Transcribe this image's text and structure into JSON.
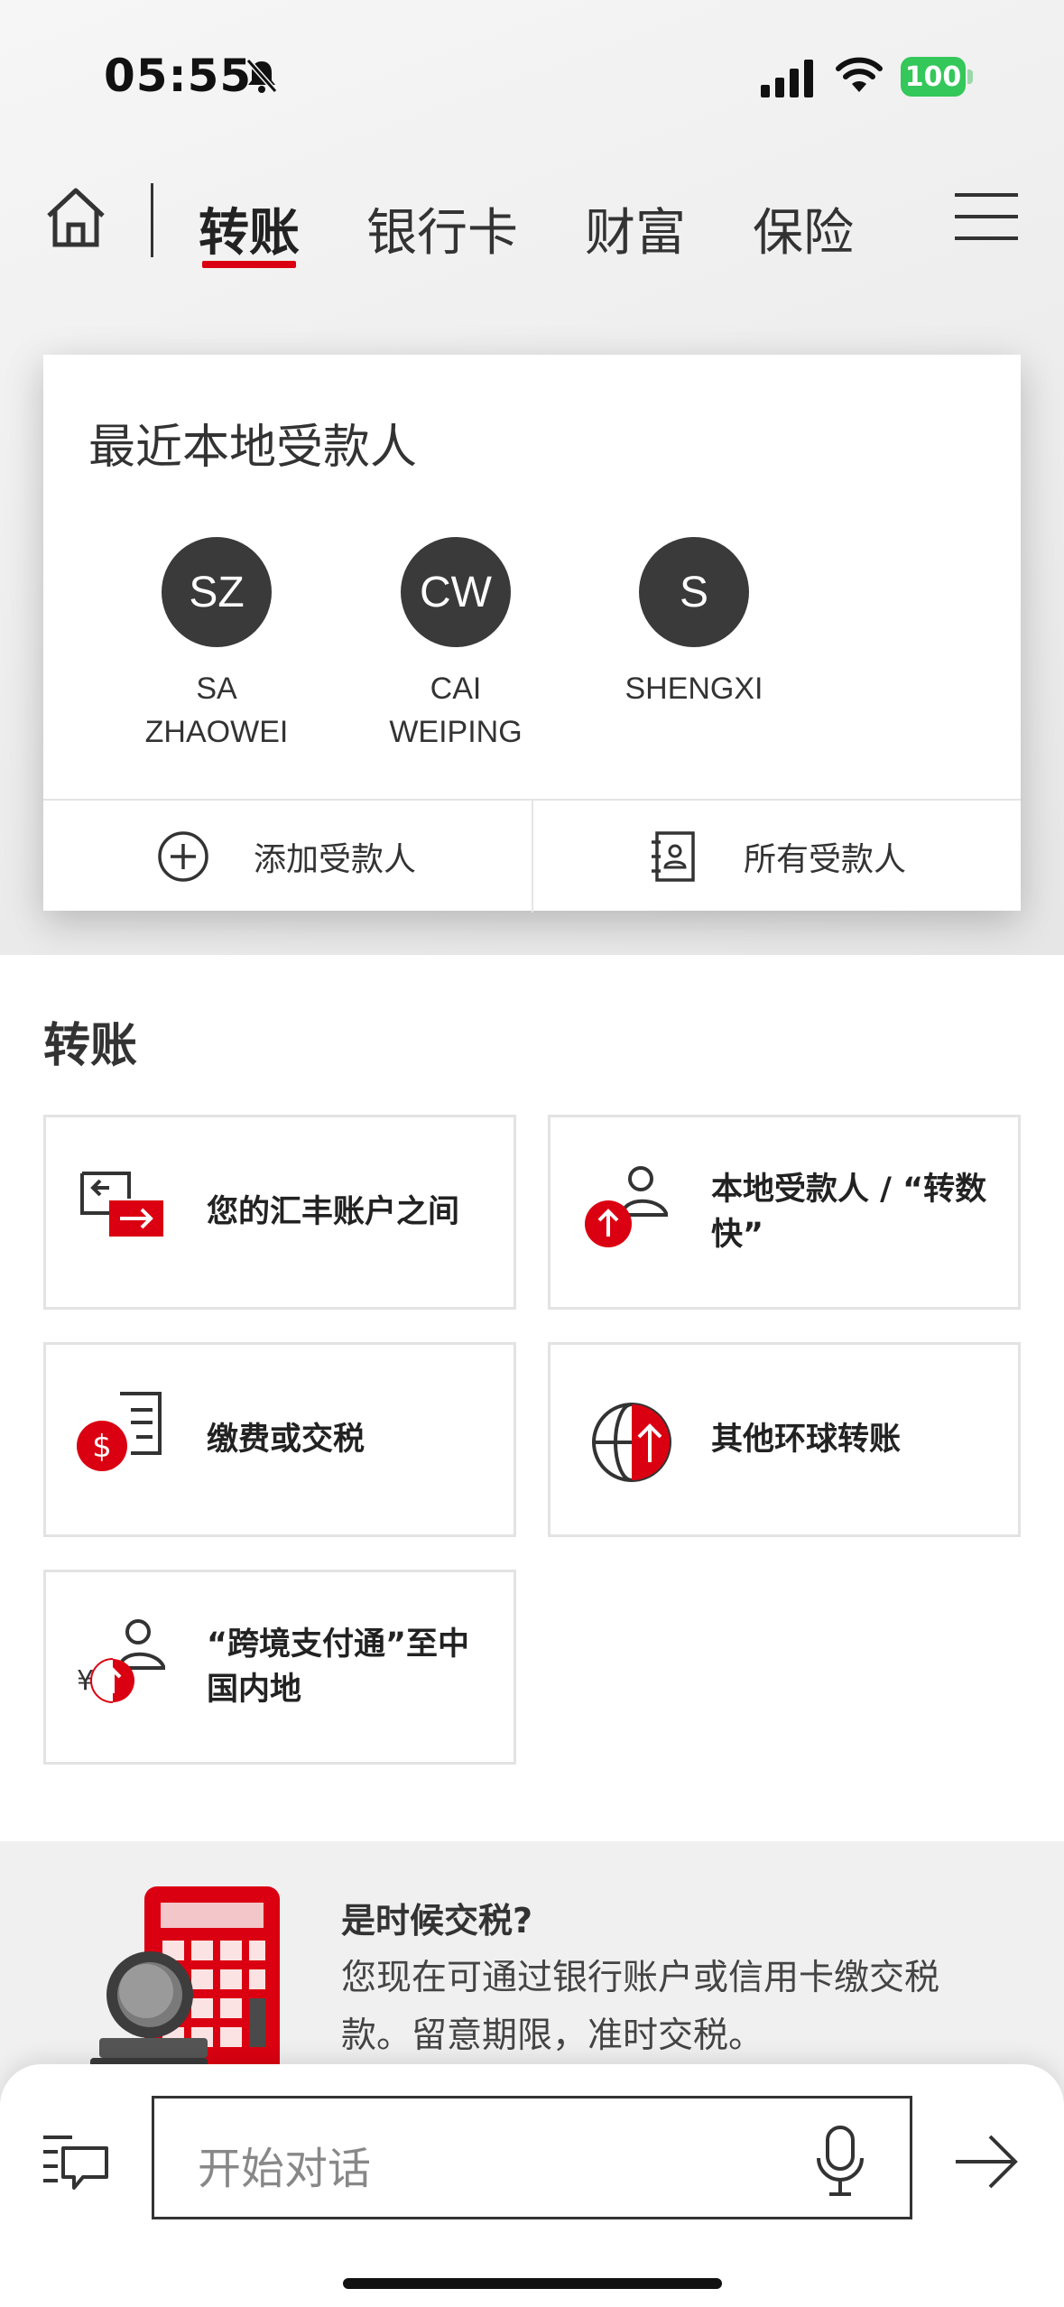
{
  "status_bar": {
    "time": "05:55",
    "battery": "100"
  },
  "nav": {
    "tabs": [
      {
        "label": "转账",
        "active": true
      },
      {
        "label": "银行卡",
        "active": false
      },
      {
        "label": "财富",
        "active": false
      },
      {
        "label": "保险",
        "active": false
      }
    ],
    "accent": "#db0011"
  },
  "recent_payees": {
    "title": "最近本地受款人",
    "payees": [
      {
        "initials": "SZ",
        "name": "SA\nZHAOWEI"
      },
      {
        "initials": "CW",
        "name": "CAI\nWEIPING"
      },
      {
        "initials": "S",
        "name": "SHENGXI"
      }
    ],
    "actions": {
      "add": "添加受款人",
      "all": "所有受款人"
    }
  },
  "transfer": {
    "title": "转账",
    "options": [
      {
        "label": "您的汇丰账户之间",
        "icon": "account-transfer-icon"
      },
      {
        "label": "本地受款人 / “转数快”",
        "icon": "local-payee-icon"
      },
      {
        "label": "缴费或交税",
        "icon": "bill-payment-icon"
      },
      {
        "label": "其他环球转账",
        "icon": "global-transfer-icon"
      },
      {
        "label": "“跨境支付通”至中国内地",
        "icon": "cross-boundary-icon"
      }
    ]
  },
  "promo": {
    "title": "是时候交税?",
    "body": "您现在可通过银行账户或信用卡缴交税款。留意期限，准时交税。"
  },
  "chat": {
    "placeholder": "开始对话"
  },
  "colors": {
    "brand_red": "#db0011",
    "avatar": "#3a3a3a",
    "battery": "#34c759"
  }
}
